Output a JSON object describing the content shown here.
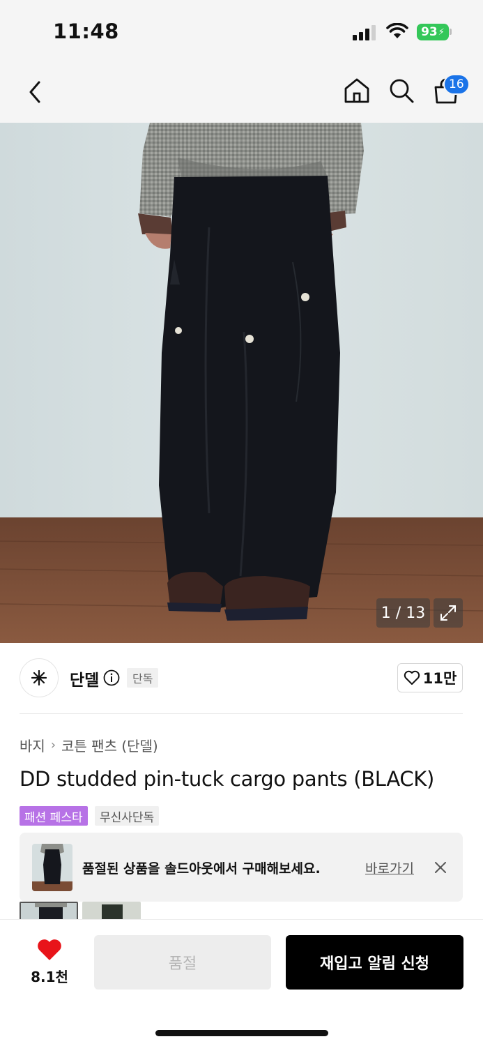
{
  "status_bar": {
    "time": "11:48",
    "battery": "93"
  },
  "nav": {
    "cart_count": "16"
  },
  "gallery": {
    "counter": "1 / 13"
  },
  "brand": {
    "name": "단델",
    "badge": "단독",
    "likes": "11만"
  },
  "breadcrumb": {
    "category": "바지",
    "subcategory": "코튼 팬츠 (단델)"
  },
  "product": {
    "title": "DD studded pin-tuck cargo pants (BLACK)",
    "tags": [
      "패션 페스타",
      "무신사단독"
    ]
  },
  "banner": {
    "message": "품절된 상품을 솔드아웃에서 구매해보세요.",
    "link": "바로가기"
  },
  "bottom_bar": {
    "like_count": "8.1천",
    "soldout_label": "품절",
    "restock_label": "재입고 알림 신청"
  },
  "colors": {
    "accent_blue": "#1a73e8",
    "fest_purple": "#b772e6",
    "heart_red": "#e8141a",
    "battery_green": "#34c759"
  }
}
